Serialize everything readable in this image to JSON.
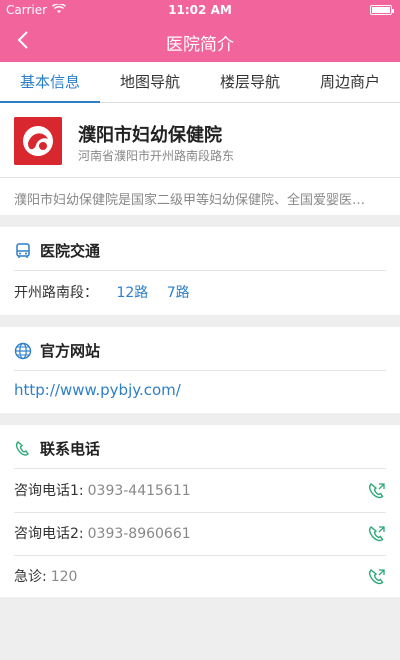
{
  "status_bar": {
    "carrier": "Carrier",
    "time": "11:02 AM"
  },
  "nav": {
    "title": "医院简介"
  },
  "tabs": [
    {
      "label": "基本信息",
      "active": true
    },
    {
      "label": "地图导航",
      "active": false
    },
    {
      "label": "楼层导航",
      "active": false
    },
    {
      "label": "周边商户",
      "active": false
    }
  ],
  "hospital": {
    "name": "濮阳市妇幼保健院",
    "address": "河南省濮阳市开州路南段路东",
    "description": "濮阳市妇幼保健院是国家二级甲等妇幼保健院、全国爱婴医…"
  },
  "traffic": {
    "title": "医院交通",
    "stop": "开州路南段：",
    "routes": [
      "12路",
      "7路"
    ]
  },
  "website": {
    "title": "官方网站",
    "url": "http://www.pybjy.com/"
  },
  "contact": {
    "title": "联系电话",
    "phones": [
      {
        "label": "咨询电话1:",
        "number": "0393-4415611"
      },
      {
        "label": "咨询电话2:",
        "number": "0393-8960661"
      },
      {
        "label": "急诊:",
        "number": "120"
      }
    ]
  },
  "colors": {
    "brand": "#f2649c",
    "accent": "#2d7fc9",
    "logo": "#d8272e",
    "phone_icon": "#2aa876"
  },
  "icons": {
    "back": "chevron-left-icon",
    "bus": "bus-icon",
    "globe": "globe-icon",
    "phone": "phone-icon"
  }
}
